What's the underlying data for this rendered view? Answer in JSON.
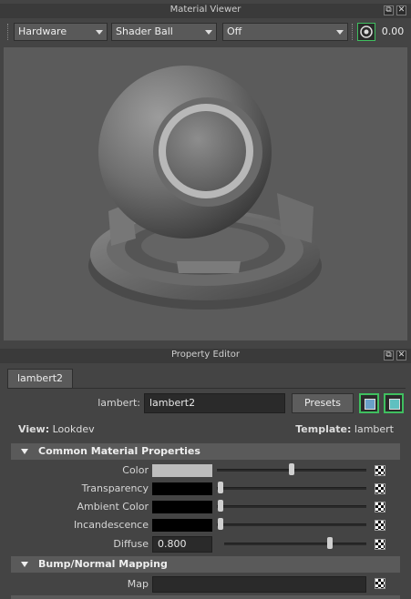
{
  "material_viewer": {
    "title": "Material Viewer",
    "renderer": "Hardware",
    "geometry": "Shader Ball",
    "environment": "Off",
    "value": "0.00"
  },
  "property_editor": {
    "title": "Property Editor",
    "tab": "lambert2",
    "node_type_label": "lambert:",
    "node_name": "lambert2",
    "presets_label": "Presets",
    "view_label": "View:",
    "view_value": "Lookdev",
    "template_label": "Template:",
    "template_value": "lambert",
    "sections": {
      "common": "Common Material Properties",
      "bump": "Bump/Normal Mapping"
    },
    "attributes": {
      "color": {
        "label": "Color",
        "swatch": "#bdbdbd",
        "slider": 0.5
      },
      "transparency": {
        "label": "Transparency",
        "swatch": "#000000",
        "slider": 0.0
      },
      "ambient": {
        "label": "Ambient Color",
        "swatch": "#000000",
        "slider": 0.0
      },
      "incandescence": {
        "label": "Incandescence",
        "swatch": "#000000",
        "slider": 0.0
      },
      "diffuse": {
        "label": "Diffuse",
        "value": "0.800",
        "slider": 0.8
      },
      "map": {
        "label": "Map",
        "value": ""
      }
    }
  },
  "colors": {
    "panel_bg": "#444444",
    "viewport_bg": "#5b5b5b",
    "section_bg": "#5a5a5a",
    "field_bg": "#2a2a2a",
    "accent_green": "#3fbf5f"
  }
}
